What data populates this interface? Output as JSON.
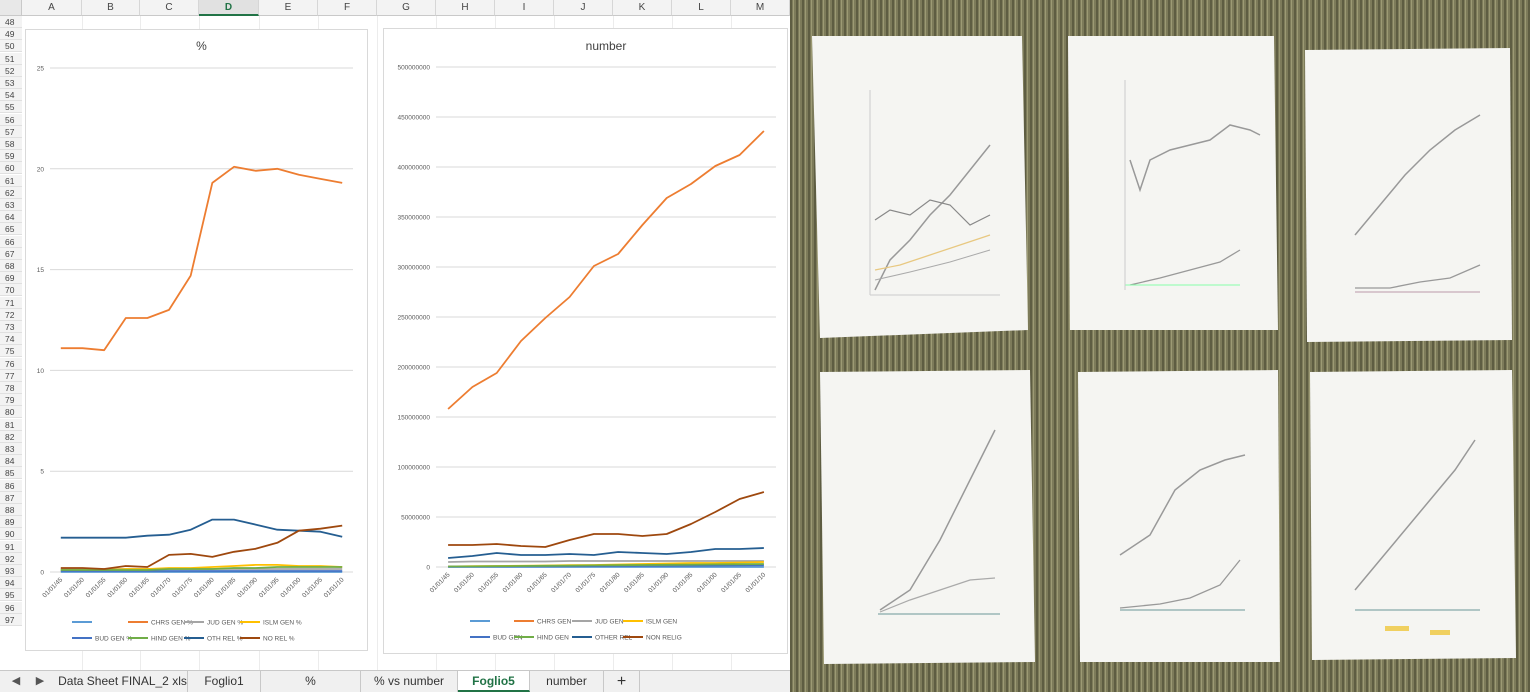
{
  "sheet": {
    "columns": [
      "A",
      "B",
      "C",
      "D",
      "E",
      "F",
      "G",
      "H",
      "I",
      "J",
      "K",
      "L",
      "M"
    ],
    "active_column": "D",
    "rows": [
      "48",
      "49",
      "50",
      "51",
      "52",
      "53",
      "54",
      "55",
      "56",
      "57",
      "58",
      "59",
      "60",
      "61",
      "62",
      "63",
      "64",
      "65",
      "66",
      "67",
      "68",
      "69",
      "70",
      "71",
      "72",
      "73",
      "74",
      "75",
      "76",
      "77",
      "78",
      "79",
      "80",
      "81",
      "82",
      "83",
      "84",
      "85",
      "86",
      "87",
      "88",
      "89",
      "90",
      "91",
      "92",
      "93",
      "94",
      "95",
      "96",
      "97"
    ]
  },
  "tabs": {
    "prev_icon": "triangle-left-icon",
    "next_icon": "triangle-right-icon",
    "items": [
      "Data Sheet FINAL_2 xls",
      "Foglio1",
      "%",
      "% vs number",
      "Foglio5",
      "number"
    ],
    "active": "Foglio5",
    "add_label": "+"
  },
  "colors": {
    "chrs": "#ed7d31",
    "jud": "#a5a5a5",
    "islm": "#ffc000",
    "bud": "#4472c4",
    "hind": "#70ad47",
    "oth": "#255e91",
    "norel": "#9e480e",
    "first": "#5b9bd5",
    "excel_green": "#217346"
  },
  "chart_data": [
    {
      "type": "line",
      "title": "%",
      "categories": [
        "01/01/45",
        "01/01/50",
        "01/01/55",
        "01/01/60",
        "01/01/65",
        "01/01/70",
        "01/01/75",
        "01/01/80",
        "01/01/85",
        "01/01/90",
        "01/01/95",
        "01/01/00",
        "01/01/05",
        "01/01/10"
      ],
      "ylim": [
        0,
        25
      ],
      "yticks": [
        "0",
        "5",
        "10",
        "15",
        "20",
        "25"
      ],
      "legend": "bottom",
      "grid": true,
      "series": [
        {
          "name": "",
          "color": "#5b9bd5",
          "values": [
            0,
            0,
            0,
            0,
            0,
            0,
            0,
            0,
            0,
            0,
            0,
            0,
            0,
            0
          ]
        },
        {
          "name": "CHRS GEN %",
          "color": "#ed7d31",
          "values": [
            11.1,
            11.1,
            11.0,
            12.6,
            12.6,
            13.0,
            14.7,
            19.3,
            20.1,
            19.9,
            20.0,
            19.7,
            19.5,
            19.3
          ]
        },
        {
          "name": "JUD GEN %",
          "color": "#a5a5a5",
          "values": [
            0.15,
            0.15,
            0.15,
            0.15,
            0.15,
            0.15,
            0.15,
            0.15,
            0.15,
            0.15,
            0.15,
            0.15,
            0.15,
            0.15
          ]
        },
        {
          "name": "ISLM GEN %",
          "color": "#ffc000",
          "values": [
            0.1,
            0.1,
            0.1,
            0.15,
            0.15,
            0.2,
            0.2,
            0.25,
            0.3,
            0.35,
            0.35,
            0.3,
            0.3,
            0.25
          ]
        },
        {
          "name": "BUD GEN %",
          "color": "#4472c4",
          "values": [
            0.05,
            0.05,
            0.05,
            0.05,
            0.05,
            0.05,
            0.05,
            0.05,
            0.05,
            0.05,
            0.05,
            0.05,
            0.05,
            0.05
          ]
        },
        {
          "name": "HIND GEN %",
          "color": "#70ad47",
          "values": [
            0.1,
            0.1,
            0.1,
            0.1,
            0.1,
            0.15,
            0.15,
            0.15,
            0.2,
            0.2,
            0.25,
            0.25,
            0.25,
            0.25
          ]
        },
        {
          "name": "OTH REL %",
          "color": "#255e91",
          "values": [
            1.7,
            1.7,
            1.7,
            1.7,
            1.8,
            1.85,
            2.1,
            2.6,
            2.6,
            2.35,
            2.1,
            2.05,
            2.0,
            1.75
          ]
        },
        {
          "name": "NO REL %",
          "color": "#9e480e",
          "values": [
            0.2,
            0.2,
            0.15,
            0.3,
            0.25,
            0.85,
            0.9,
            0.75,
            1.0,
            1.15,
            1.45,
            2.05,
            2.15,
            2.3
          ]
        }
      ]
    },
    {
      "type": "line",
      "title": "number",
      "categories": [
        "01/01/45",
        "01/01/50",
        "01/01/55",
        "01/01/60",
        "01/01/65",
        "01/01/70",
        "01/01/75",
        "01/01/80",
        "01/01/85",
        "01/01/90",
        "01/01/95",
        "01/01/00",
        "01/01/05",
        "01/01/10"
      ],
      "ylim": [
        0,
        500000000
      ],
      "yticks": [
        "0",
        "50000000",
        "100000000",
        "150000000",
        "200000000",
        "250000000",
        "300000000",
        "350000000",
        "400000000",
        "450000000",
        "500000000"
      ],
      "legend": "bottom",
      "grid": true,
      "series": [
        {
          "name": "",
          "color": "#5b9bd5",
          "values": [
            0,
            0,
            0,
            0,
            0,
            0,
            0,
            0,
            0,
            0,
            0,
            0,
            0,
            0
          ]
        },
        {
          "name": "CHRS GEN",
          "color": "#ed7d31",
          "values": [
            158000000,
            180000000,
            194000000,
            226000000,
            249000000,
            270000000,
            301000000,
            313000000,
            342000000,
            369000000,
            383000000,
            401000000,
            412000000,
            436000000
          ]
        },
        {
          "name": "JUD GEN",
          "color": "#a5a5a5",
          "values": [
            5000000,
            5500000,
            5500000,
            5500000,
            5500000,
            6000000,
            6000000,
            6000000,
            6000000,
            6000000,
            6000000,
            6000000,
            6000000,
            6000000
          ]
        },
        {
          "name": "ISLM GEN",
          "color": "#ffc000",
          "values": [
            500000,
            800000,
            1000000,
            1200000,
            1500000,
            1800000,
            2000000,
            2500000,
            3000000,
            3500000,
            4000000,
            4000000,
            4500000,
            5000000
          ]
        },
        {
          "name": "BUD GEN",
          "color": "#4472c4",
          "values": [
            300000,
            400000,
            500000,
            600000,
            700000,
            800000,
            900000,
            1000000,
            1100000,
            1200000,
            1300000,
            1400000,
            1500000,
            1700000
          ]
        },
        {
          "name": "HIND GEN",
          "color": "#70ad47",
          "values": [
            500000,
            600000,
            800000,
            1000000,
            1200000,
            1400000,
            1600000,
            1800000,
            2000000,
            2200000,
            2400000,
            2600000,
            2800000,
            3000000
          ]
        },
        {
          "name": "OTHER REL",
          "color": "#255e91",
          "values": [
            9000000,
            11000000,
            14000000,
            12000000,
            12000000,
            13000000,
            12000000,
            15000000,
            14000000,
            13000000,
            15000000,
            18000000,
            18000000,
            19000000
          ]
        },
        {
          "name": "NON RELIG",
          "color": "#9e480e",
          "values": [
            22000000,
            22000000,
            23000000,
            21000000,
            20000000,
            27000000,
            33000000,
            33000000,
            31000000,
            33000000,
            43000000,
            55000000,
            68000000,
            75000000
          ]
        }
      ]
    }
  ]
}
